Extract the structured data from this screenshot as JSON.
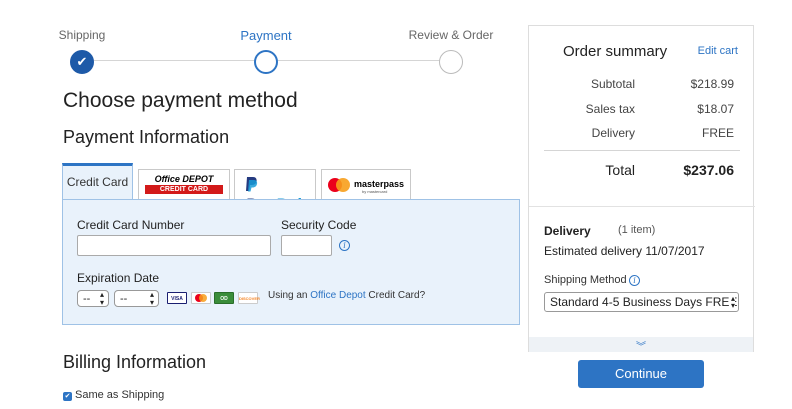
{
  "stepper": {
    "steps": [
      {
        "label": "Shipping",
        "state": "done"
      },
      {
        "label": "Payment",
        "state": "active"
      },
      {
        "label": "Review & Order",
        "state": "pending"
      }
    ]
  },
  "main": {
    "title": "Choose payment method",
    "payment_info_heading": "Payment Information",
    "billing_heading": "Billing Information"
  },
  "tabs": {
    "credit_card": "Credit Card",
    "office_depot": {
      "top": "Office DEPOT",
      "bottom": "CREDIT CARD"
    },
    "paypal": {
      "pay": "Pay",
      "pal": "Pal"
    },
    "masterpass": {
      "name": "masterpass",
      "sub": "by mastercard"
    }
  },
  "card_form": {
    "card_number_label": "Credit Card Number",
    "card_number_value": "",
    "security_code_label": "Security Code",
    "security_code_value": "",
    "expiration_label": "Expiration Date",
    "month_value": "--",
    "year_value": "--",
    "card_logos": [
      "VISA",
      "MC",
      "OD",
      "DISCOVER"
    ],
    "using_prefix": "Using an ",
    "using_link": "Office Depot",
    "using_suffix": " Credit Card?"
  },
  "billing": {
    "same_as_shipping_label": "Same as Shipping",
    "same_as_shipping_checked": true
  },
  "summary": {
    "title": "Order summary",
    "edit_cart": "Edit cart",
    "rows": [
      {
        "label": "Subtotal",
        "value": "$218.99"
      },
      {
        "label": "Sales tax",
        "value": "$18.07"
      },
      {
        "label": "Delivery",
        "value": "FREE"
      }
    ],
    "total_label": "Total",
    "total_value": "$237.06",
    "delivery_title": "Delivery",
    "delivery_count": "(1 item)",
    "estimated_delivery": "Estimated delivery 11/07/2017",
    "shipping_method_label": "Shipping Method",
    "shipping_method_value": "Standard 4-5 Business Days FREE"
  },
  "continue_label": "Continue",
  "colors": {
    "accent": "#2d74c4",
    "panel_bg": "#e9f2fb",
    "step_done": "#1e5aa8",
    "od_red": "#d31a1a"
  }
}
